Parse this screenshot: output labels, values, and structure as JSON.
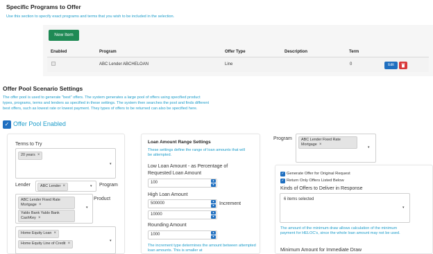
{
  "programs": {
    "title": "Specific Programs to Offer",
    "hint": "Use this section to specify exact programs and terms that you wish to be included in the selection.",
    "new_item_label": "New Item",
    "columns": [
      "Enabled",
      "Program",
      "Offer Type",
      "Description",
      "Term"
    ],
    "rows": [
      {
        "program": "ABC Lender ABCHELOAN",
        "offer_type": "Line",
        "description": "",
        "term": "0",
        "edit_label": "Edit"
      }
    ]
  },
  "scenario": {
    "title": "Offer Pool Scenario Settings",
    "hint_line1": "The offer pool is used to generate \"best\" offers. The system generates a large pool of offers using specified product",
    "hint_line2": "types, programs, terms and lenders as specified in these settings. The system then searches the pool and finds different",
    "hint_line3": "best offers, such as lowest rate or lowest payment. They types of offers to be returned can also be specified here.",
    "enabled_label": "Offer Pool Enabled"
  },
  "left_panel": {
    "terms_label": "Terms to Try",
    "terms_chips": [
      "20 years"
    ],
    "lender_label": "Lender",
    "lender_value": "ABC Lender",
    "program_label": "Program",
    "product_label": "Product",
    "program_chips": [
      "ABC Lender Fixed Rate Mortgage",
      "Yaldo Bank Yaldo Bank CashKey"
    ],
    "product_chips": [
      "Home Equity Loan",
      "Home Equity Line of Credit"
    ]
  },
  "loan_panel": {
    "title": "Loan Amount Range Settings",
    "hint": "These settings define the range of loan amounts that will be attempted.",
    "low_label": "Low Loan Amount - as Percentage of Requested Loan Amount",
    "low_value": "100",
    "high_label": "High Loan Amount",
    "high_value": "500000",
    "increment_label": "Increment",
    "increment_value": "10000",
    "rounding_label": "Rounding Amount",
    "rounding_value": "1000",
    "increment_hint": "The increment type determines the amount between attempted loan amounts. This is smaller at"
  },
  "right_panel": {
    "program_label": "Program",
    "program_chip": "ABC Lender Fixed Rate Mortgage",
    "check1_label": "Generate Offer for Original Request",
    "check2_label": "Return Only Offers Listed Below",
    "kinds_label": "Kinds of Offers to Deliver in Response",
    "kinds_value": "6 items selected",
    "draw_hint": "The amount of the minimum draw allows calculation of the minimum payment for HELOC's, since the whole loan amount may not be used.",
    "min_draw_label": "Minimum Amount for Immediate Draw"
  }
}
